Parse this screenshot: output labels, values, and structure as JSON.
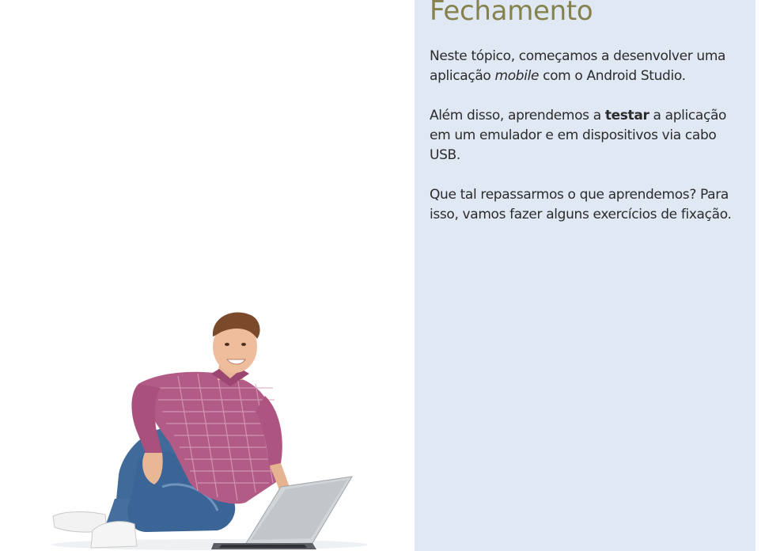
{
  "left": {
    "illustration": "young-man-with-laptop-photo"
  },
  "right": {
    "title": "Fechamento",
    "p1": {
      "before": "Neste tópico, começamos a desenvolver uma aplicação ",
      "em": "mobile",
      "after": " com o Android Studio."
    },
    "p2": {
      "before": "Além disso, aprendemos a ",
      "strong": "testar",
      "after": " a aplicação em um emulador e em dispositivos via cabo USB."
    },
    "p3": "Que tal repassarmos o que aprendemos? Para isso, vamos fazer alguns exercícios de fixação."
  },
  "colors": {
    "panel_bg": "#e0e8f4",
    "title": "#85824e",
    "text": "#2b2b2b"
  }
}
